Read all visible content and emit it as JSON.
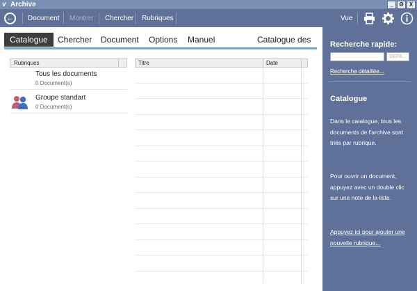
{
  "window": {
    "title": "Archive",
    "controls": [
      "_",
      "Θ",
      "X"
    ]
  },
  "toolbar": {
    "items": [
      {
        "label": "Document",
        "enabled": true
      },
      {
        "label": "Montrer",
        "enabled": false
      },
      {
        "label": "Chercher",
        "enabled": true
      },
      {
        "label": "Rubriques",
        "enabled": true
      }
    ],
    "view_label": "Vue",
    "icons": [
      "print-icon",
      "gear-icon",
      "info-icon"
    ]
  },
  "tabs": [
    "Catalogue",
    "Chercher",
    "Document",
    "Options",
    "Manuel"
  ],
  "active_tab": "Catalogue",
  "panel_title": "Catalogue des",
  "rubriques": {
    "header": "Rubriques",
    "items": [
      {
        "name": "Tous les documents",
        "count": "0 Document(s)",
        "icon": ""
      },
      {
        "name": "Groupe standart",
        "count": "0 Document(s)",
        "icon": "group-icon"
      }
    ]
  },
  "documents": {
    "columns": [
      "Titre",
      "Date"
    ],
    "rows": []
  },
  "sidebar": {
    "quick_search_title": "Recherche rapide:",
    "quick_search_value": "",
    "quick_search_button": "DEPA...",
    "detailed_search_link": "Recherche détaillée...",
    "section_title": "Catalogue",
    "paragraph1": "Dans le catalogue, tous les documents de l'archive sont triés par rubrique.",
    "paragraph2": "Pour ouvrir un document, appuyez avec un double clic sur une note de la liste.",
    "add_link": "Appuyez ici pour ajouter une nouvelle rubrique..."
  },
  "colors": {
    "toolbar": "#5f7199",
    "titlebar": "#7b8fb4",
    "tab_active": "#3d3d3d",
    "accent_line": "#7da2c8"
  }
}
